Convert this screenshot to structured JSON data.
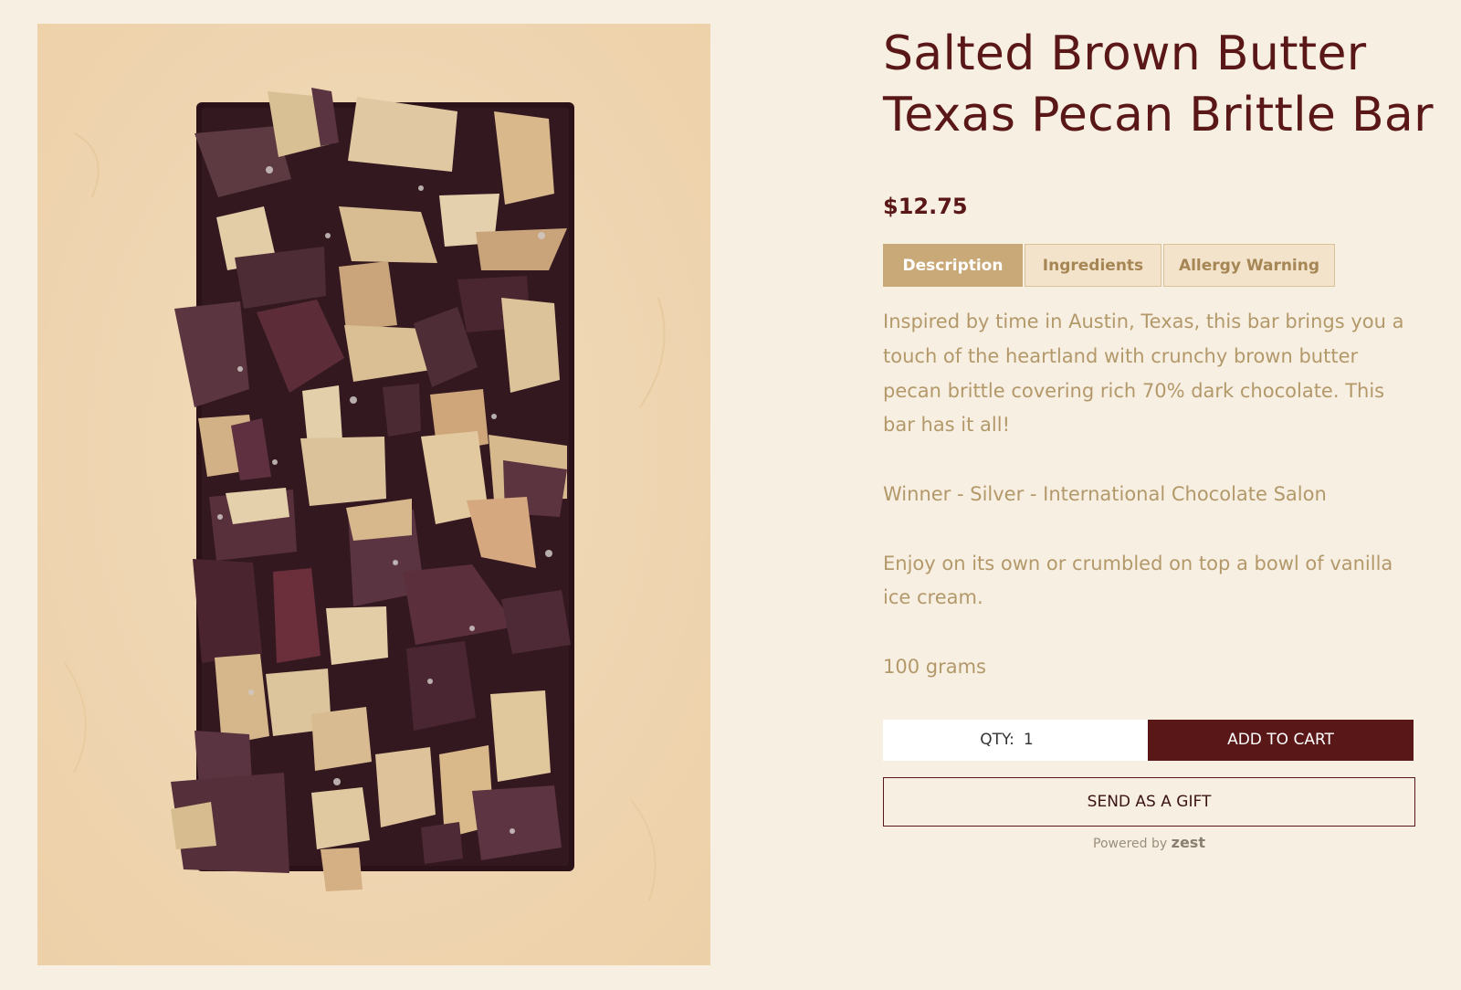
{
  "product": {
    "title_line1": "Salted Brown Butter",
    "title_line2": "Texas Pecan Brittle Bar",
    "price": "$12.75",
    "image_alt": "chocolate bar topped with pecan brittle"
  },
  "tabs": [
    {
      "label": "Description",
      "active": true
    },
    {
      "label": "Ingredients",
      "active": false
    },
    {
      "label": "Allergy Warning",
      "active": false
    }
  ],
  "description": {
    "paragraph1": "Inspired by time in Austin, Texas, this bar brings you a touch of the heartland with crunchy brown butter pecan brittle covering rich 70% dark chocolate. This bar has it all!",
    "paragraph2": "Winner - Silver - International Chocolate Salon",
    "paragraph3": "Enjoy on its own or crumbled on top a bowl of vanilla ice cream.",
    "weight": "100 grams"
  },
  "purchase": {
    "qty_label": "QTY:",
    "qty_value": "1",
    "add_to_cart_label": "ADD TO CART",
    "gift_label": "SEND AS A GIFT",
    "powered_by_text": "Powered by",
    "powered_by_brand": "zest"
  },
  "colors": {
    "page_background": "#f8efe3",
    "brand_dark": "#5a1717",
    "accent_tan": "#c9a977",
    "body_text": "#b3996a"
  }
}
